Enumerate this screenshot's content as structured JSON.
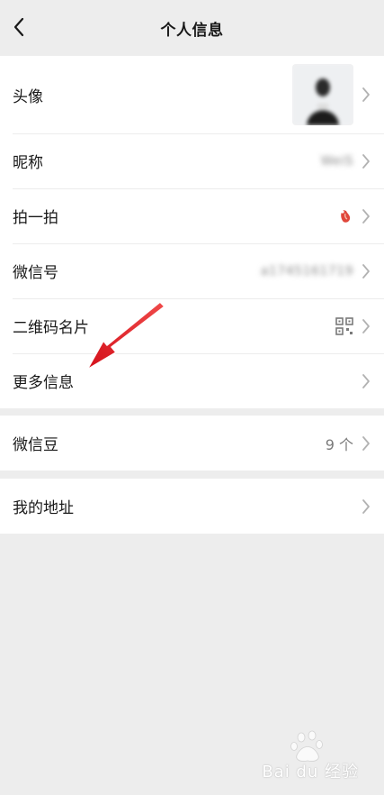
{
  "navbar": {
    "title": "个人信息"
  },
  "profile_group": {
    "items": [
      {
        "label": "头像",
        "value": ""
      },
      {
        "label": "昵称",
        "value": "WeiS"
      },
      {
        "label": "拍一拍",
        "value": ""
      },
      {
        "label": "微信号",
        "value": "a1745161719"
      },
      {
        "label": "二维码名片",
        "value": ""
      },
      {
        "label": "更多信息",
        "value": ""
      }
    ]
  },
  "beans_group": {
    "label": "微信豆",
    "value": "9 个"
  },
  "address_group": {
    "label": "我的地址"
  },
  "watermark": {
    "text": "Bai du 经验"
  },
  "colors": {
    "background": "#ededed",
    "surface": "#ffffff",
    "text_primary": "#191919",
    "text_secondary": "#7a7a7a",
    "chevron": "#b2b2b2",
    "annotation_arrow": "#e0141e"
  },
  "icons": {
    "back": "chevron-left-icon",
    "row_arrow": "chevron-right-icon",
    "pat": "pat-emoji-icon",
    "qr": "qr-code-icon"
  }
}
